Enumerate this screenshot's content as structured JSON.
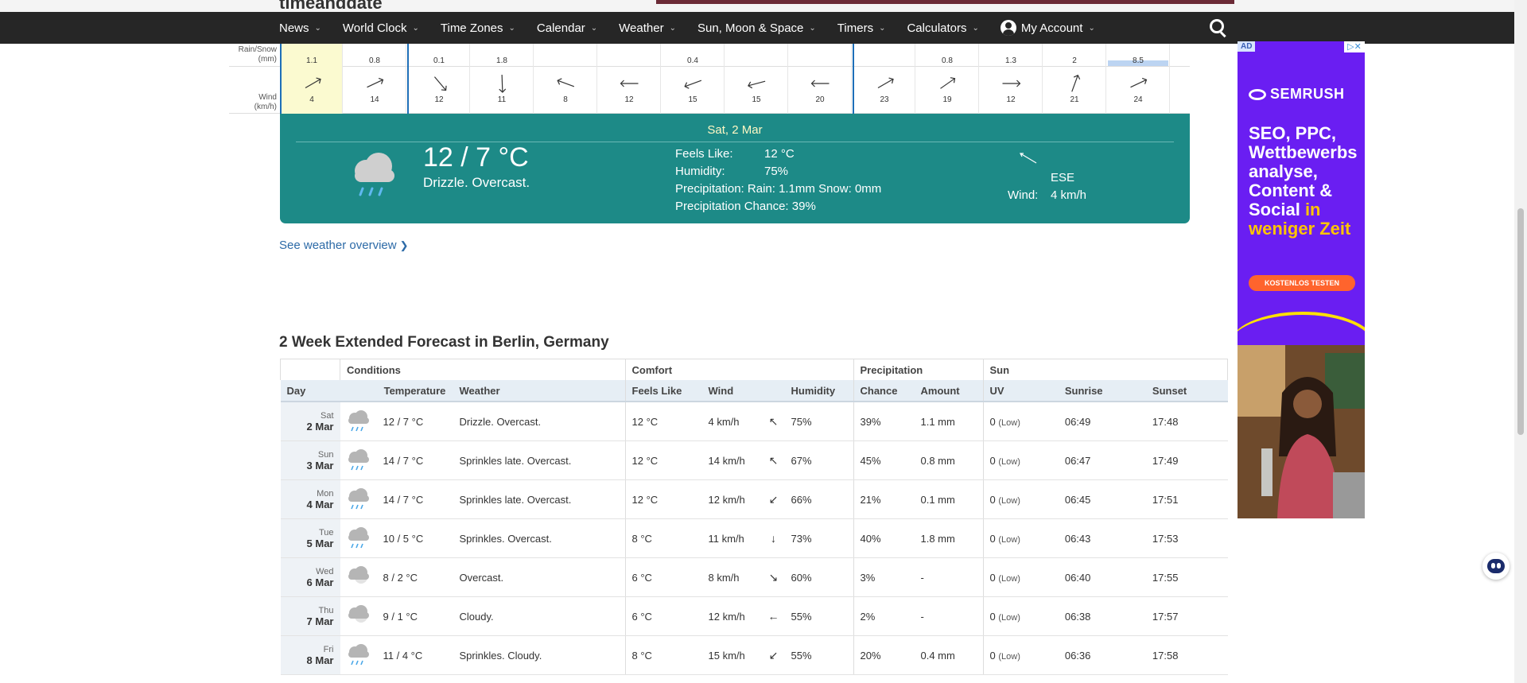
{
  "site": {
    "logo_fragment": "timeanddate"
  },
  "nav": {
    "items": [
      "News",
      "World Clock",
      "Time Zones",
      "Calendar",
      "Weather",
      "Sun, Moon & Space",
      "Timers",
      "Calculators"
    ],
    "account_label": "My Account"
  },
  "hourly": {
    "rain_label": "Rain/Snow\n(mm)",
    "wind_label": "Wind\n(km/h)",
    "cells": [
      {
        "rain": "1.1",
        "wind": "4",
        "angle": -30
      },
      {
        "rain": "0.8",
        "wind": "14",
        "angle": -25
      },
      {
        "rain": "0.1",
        "wind": "12",
        "angle": 50
      },
      {
        "rain": "1.8",
        "wind": "11",
        "angle": 88
      },
      {
        "rain": "",
        "wind": "8",
        "angle": 200
      },
      {
        "rain": "",
        "wind": "12",
        "angle": 180
      },
      {
        "rain": "0.4",
        "wind": "15",
        "angle": 160
      },
      {
        "rain": "",
        "wind": "15",
        "angle": 165
      },
      {
        "rain": "",
        "wind": "20",
        "angle": 180
      },
      {
        "rain": "",
        "wind": "23",
        "angle": -30
      },
      {
        "rain": "0.8",
        "wind": "19",
        "angle": -35
      },
      {
        "rain": "1.3",
        "wind": "12",
        "angle": 0
      },
      {
        "rain": "2",
        "wind": "21",
        "angle": -70
      },
      {
        "rain": "8.5",
        "wind": "24",
        "angle": -25
      }
    ]
  },
  "detail": {
    "date": "Sat, 2 Mar",
    "temp": "12 / 7 °C",
    "condition": "Drizzle. Overcast.",
    "feels_like_k": "Feels Like:",
    "feels_like_v": "12 °C",
    "humidity_k": "Humidity:",
    "humidity_v": "75%",
    "precip_k": "Precipitation:",
    "precip_v": "Rain: 1.1mm Snow: 0mm",
    "chance_k": "Precipitation Chance:",
    "chance_v": "39%",
    "wind_dir": "ESE",
    "wind_k": "Wind:",
    "wind_v": "4 km/h"
  },
  "overview_link": "See weather overview",
  "forecast": {
    "title": "2 Week Extended Forecast in Berlin, Germany",
    "groups": {
      "conditions": "Conditions",
      "comfort": "Comfort",
      "precipitation": "Precipitation",
      "sun": "Sun"
    },
    "columns": {
      "day": "Day",
      "temperature": "Temperature",
      "weather": "Weather",
      "feels_like": "Feels Like",
      "wind": "Wind",
      "humidity": "Humidity",
      "chance": "Chance",
      "amount": "Amount",
      "uv": "UV",
      "sunrise": "Sunrise",
      "sunset": "Sunset"
    },
    "rows": [
      {
        "dow": "Sat",
        "date": "2 Mar",
        "icon": "rain-cloud-icon",
        "temp": "12 / 7 °C",
        "weather": "Drizzle. Overcast.",
        "feels": "12 °C",
        "wind": "4 km/h",
        "wind_arrow": "↖",
        "humidity": "75%",
        "chance": "39%",
        "amount": "1.1 mm",
        "uv": "0",
        "uv_level": "(Low)",
        "sunrise": "06:49",
        "sunset": "17:48"
      },
      {
        "dow": "Sun",
        "date": "3 Mar",
        "icon": "rain-cloud-icon",
        "temp": "14 / 7 °C",
        "weather": "Sprinkles late. Overcast.",
        "feels": "12 °C",
        "wind": "14 km/h",
        "wind_arrow": "↖",
        "humidity": "67%",
        "chance": "45%",
        "amount": "0.8 mm",
        "uv": "0",
        "uv_level": "(Low)",
        "sunrise": "06:47",
        "sunset": "17:49"
      },
      {
        "dow": "Mon",
        "date": "4 Mar",
        "icon": "rain-cloud-icon",
        "temp": "14 / 7 °C",
        "weather": "Sprinkles late. Overcast.",
        "feels": "12 °C",
        "wind": "12 km/h",
        "wind_arrow": "↙",
        "humidity": "66%",
        "chance": "21%",
        "amount": "0.1 mm",
        "uv": "0",
        "uv_level": "(Low)",
        "sunrise": "06:45",
        "sunset": "17:51"
      },
      {
        "dow": "Tue",
        "date": "5 Mar",
        "icon": "rain-cloud-icon",
        "temp": "10 / 5 °C",
        "weather": "Sprinkles. Overcast.",
        "feels": "8 °C",
        "wind": "11 km/h",
        "wind_arrow": "↓",
        "humidity": "73%",
        "chance": "40%",
        "amount": "1.8 mm",
        "uv": "0",
        "uv_level": "(Low)",
        "sunrise": "06:43",
        "sunset": "17:53"
      },
      {
        "dow": "Wed",
        "date": "6 Mar",
        "icon": "cloud-icon",
        "temp": "8 / 2 °C",
        "weather": "Overcast.",
        "feels": "6 °C",
        "wind": "8 km/h",
        "wind_arrow": "↘",
        "humidity": "60%",
        "chance": "3%",
        "amount": "-",
        "uv": "0",
        "uv_level": "(Low)",
        "sunrise": "06:40",
        "sunset": "17:55"
      },
      {
        "dow": "Thu",
        "date": "7 Mar",
        "icon": "cloud-icon",
        "temp": "9 / 1 °C",
        "weather": "Cloudy.",
        "feels": "6 °C",
        "wind": "12 km/h",
        "wind_arrow": "←",
        "humidity": "55%",
        "chance": "2%",
        "amount": "-",
        "uv": "0",
        "uv_level": "(Low)",
        "sunrise": "06:38",
        "sunset": "17:57"
      },
      {
        "dow": "Fri",
        "date": "8 Mar",
        "icon": "rain-cloud-icon",
        "temp": "11 / 4 °C",
        "weather": "Sprinkles. Cloudy.",
        "feels": "8 °C",
        "wind": "15 km/h",
        "wind_arrow": "↙",
        "humidity": "55%",
        "chance": "20%",
        "amount": "0.4 mm",
        "uv": "0",
        "uv_level": "(Low)",
        "sunrise": "06:36",
        "sunset": "17:58"
      }
    ]
  },
  "ad": {
    "tag": "AD",
    "brand": "SEMRUSH",
    "headline_1": "SEO, PPC, Wettbewerbs analyse, Content & Social",
    "headline_2": "in weniger Zeit",
    "cta": "KOSTENLOS TESTEN"
  },
  "colors": {
    "nav_bg": "#262626",
    "panel": "#1d8a87",
    "ad_bg": "#6a1ef2",
    "link": "#2c6aa7"
  }
}
